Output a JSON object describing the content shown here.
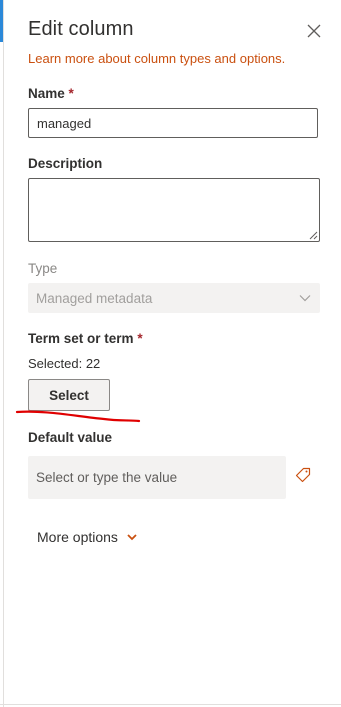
{
  "panel": {
    "title": "Edit column",
    "learn_more_link": "Learn more about column types and options."
  },
  "name_field": {
    "label": "Name",
    "required_marker": "*",
    "value": "managed"
  },
  "description_field": {
    "label": "Description",
    "value": ""
  },
  "type_field": {
    "label": "Type",
    "value": "Managed metadata",
    "disabled": true
  },
  "term_set": {
    "label": "Term set or term",
    "required_marker": "*",
    "selected_text": "Selected: 22",
    "select_button": "Select"
  },
  "default_value": {
    "label": "Default value",
    "placeholder": "Select or type the value"
  },
  "more_options": {
    "label": "More options"
  },
  "icons": {
    "close": "close-icon",
    "dropdown": "chevron-down-icon",
    "tag": "tag-icon",
    "more_options": "chevron-down-icon"
  },
  "colors": {
    "link": "#ca5010",
    "required": "#a4262c",
    "annotation": "#e00000",
    "accent": "#2b88d8"
  }
}
